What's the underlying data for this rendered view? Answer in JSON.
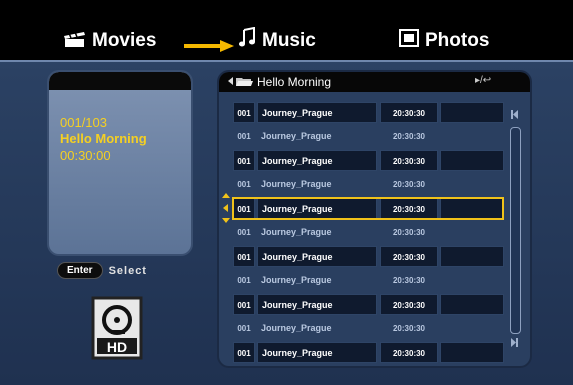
{
  "nav": {
    "tabs": [
      {
        "label": "Movies",
        "icon": "clapperboard-icon"
      },
      {
        "label": "Music",
        "icon": "music-note-icon"
      },
      {
        "label": "Photos",
        "icon": "camera-icon"
      }
    ],
    "arrow_color": "#f5b800"
  },
  "info": {
    "track": "001/103",
    "title": "Hello Morning",
    "time": "00:30:00",
    "text_color": "#f5d022"
  },
  "hint": {
    "button": "Enter",
    "action": "Select"
  },
  "storage_icon": "hd-disk-icon",
  "list": {
    "folder": "Hello Morning",
    "controls": "▸/↩",
    "selected_index": 4,
    "rows": [
      {
        "num": "001",
        "name": "Journey_Prague",
        "time": "20:30:30"
      },
      {
        "num": "001",
        "name": "Journey_Prague",
        "time": "20:30:30"
      },
      {
        "num": "001",
        "name": "Journey_Prague",
        "time": "20:30:30"
      },
      {
        "num": "001",
        "name": "Journey_Prague",
        "time": "20:30:30"
      },
      {
        "num": "001",
        "name": "Journey_Prague",
        "time": "20:30:30"
      },
      {
        "num": "001",
        "name": "Journey_Prague",
        "time": "20:30:30"
      },
      {
        "num": "001",
        "name": "Journey_Prague",
        "time": "20:30:30"
      },
      {
        "num": "001",
        "name": "Journey_Prague",
        "time": "20:30:30"
      },
      {
        "num": "001",
        "name": "Journey_Prague",
        "time": "20:30:30"
      },
      {
        "num": "001",
        "name": "Journey_Prague",
        "time": "20:30:30"
      },
      {
        "num": "001",
        "name": "Journey_Prague",
        "time": "20:30:30"
      }
    ],
    "highlight_color": "#f0c21a"
  }
}
